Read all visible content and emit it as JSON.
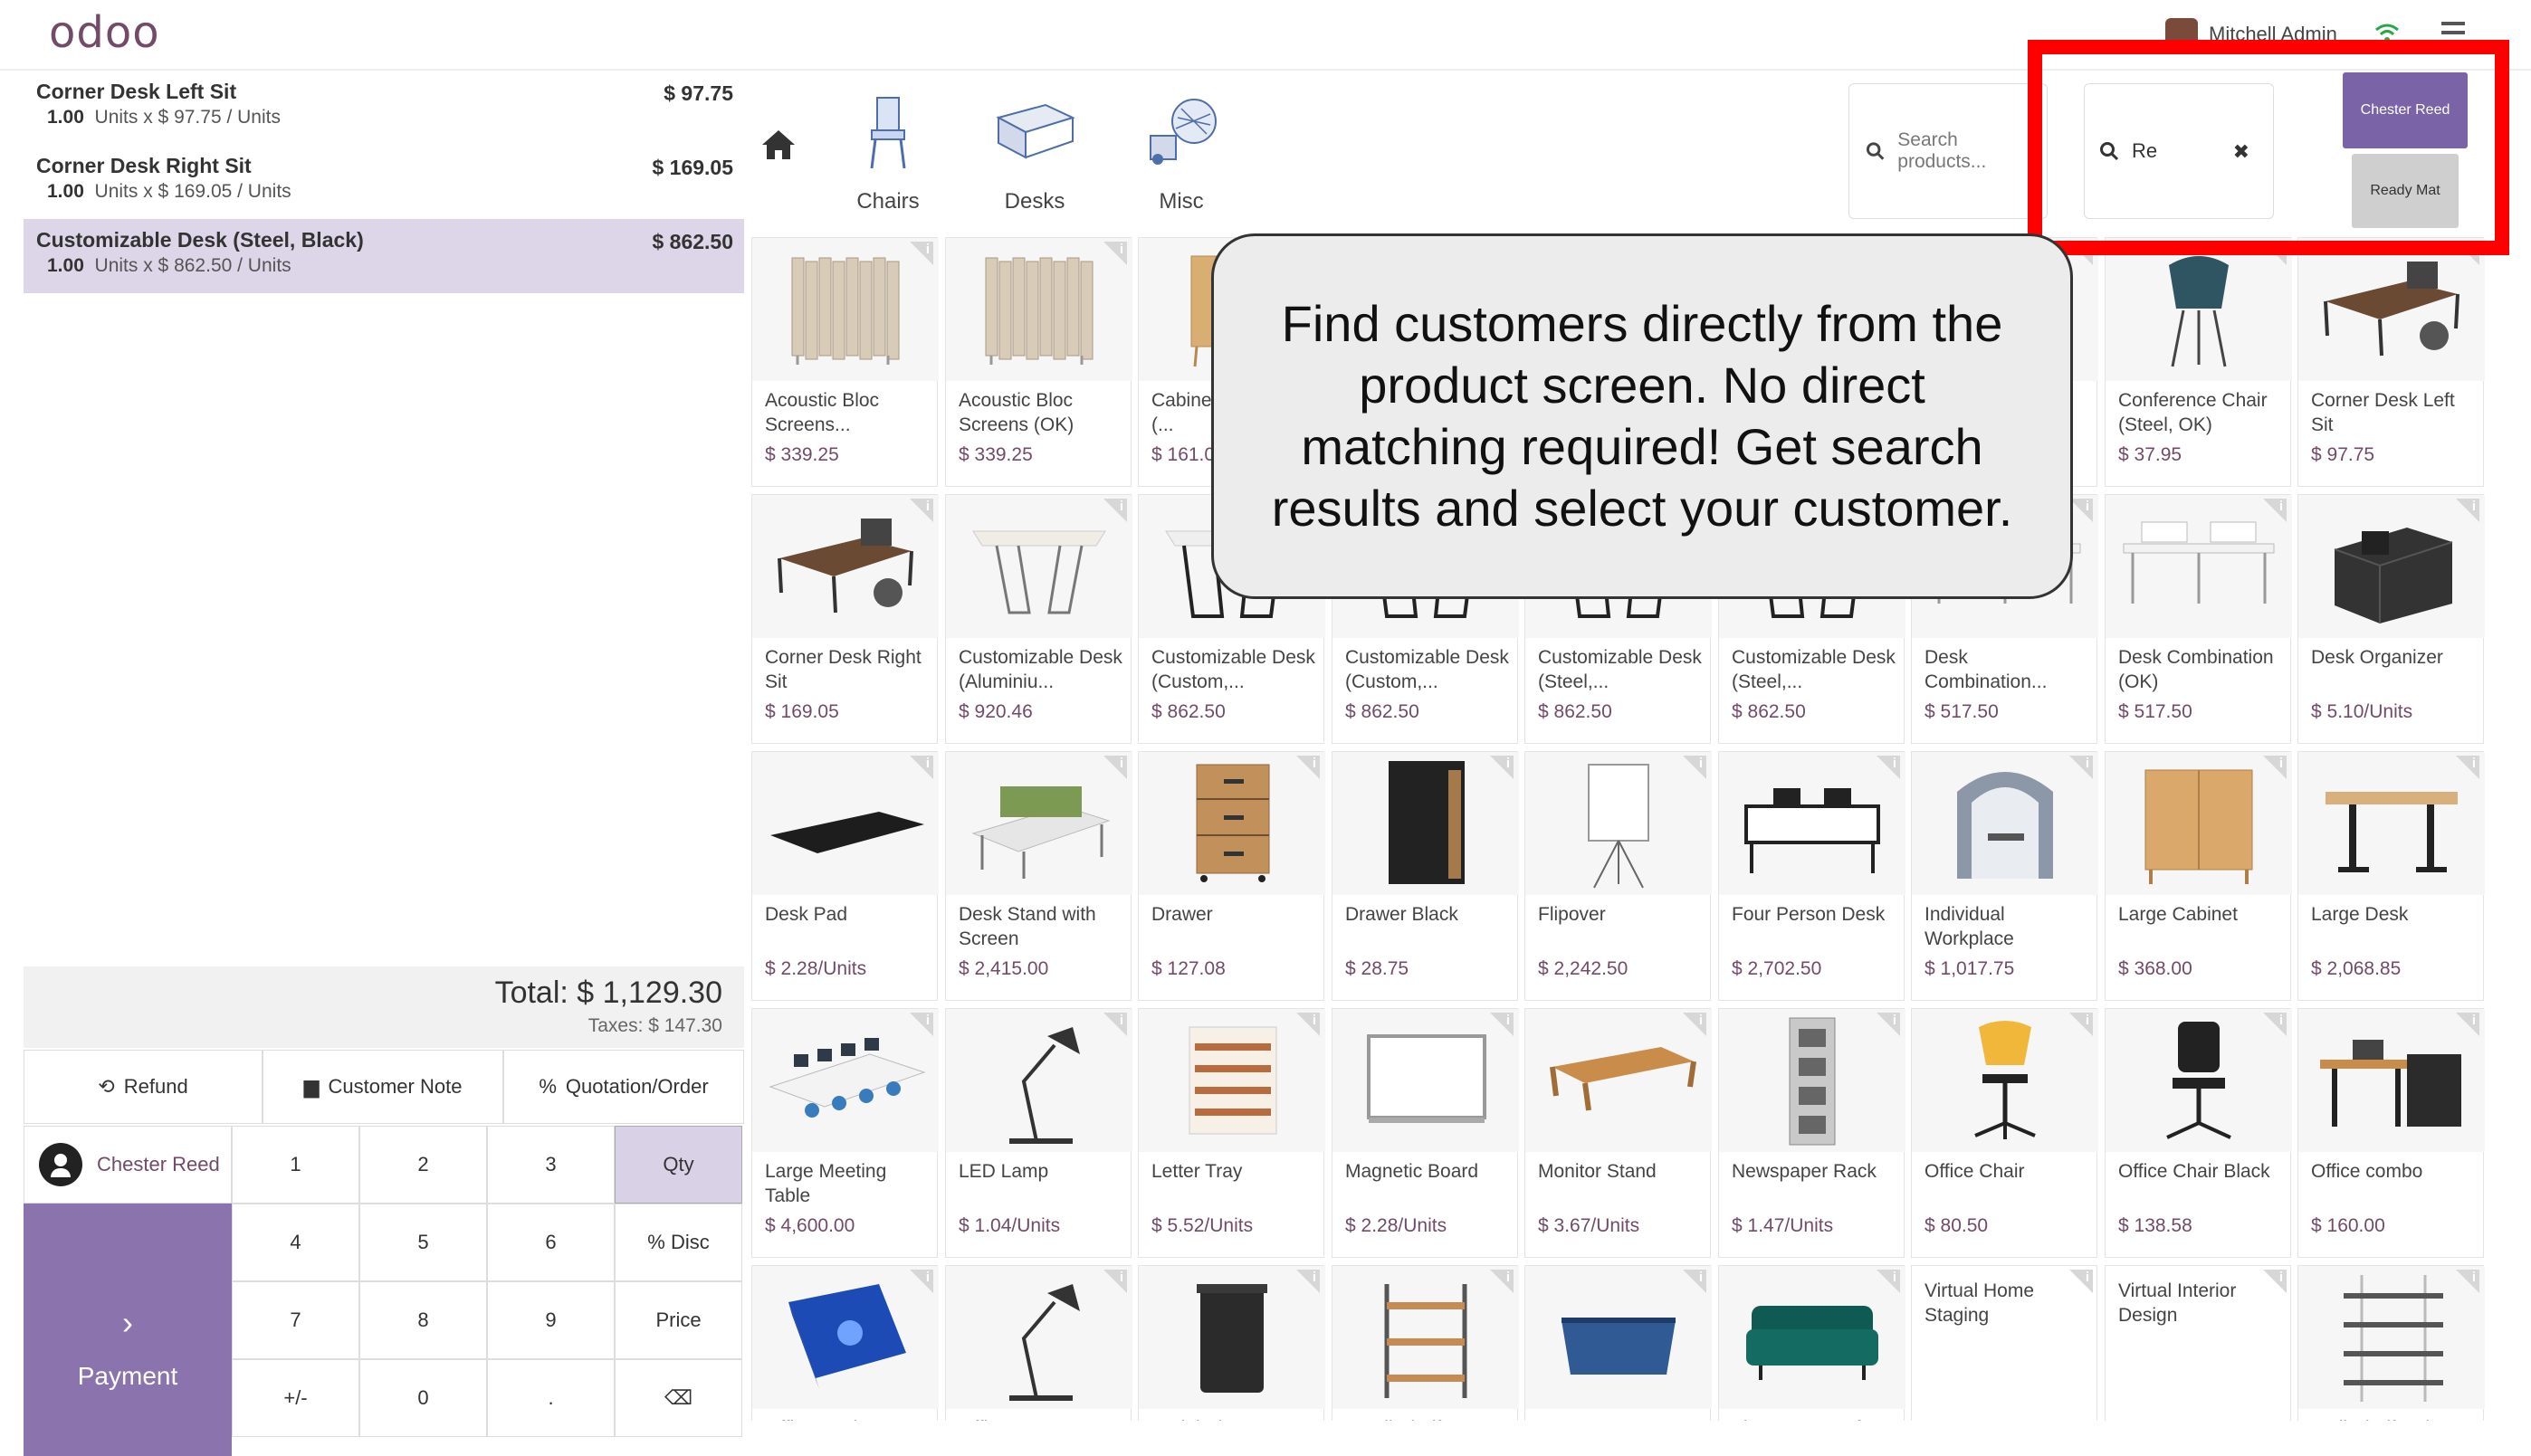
{
  "header": {
    "logo_main": "odoo",
    "user_name": "Mitchell Admin"
  },
  "order": {
    "lines": [
      {
        "name": "Corner Desk Left Sit",
        "qty": "1.00",
        "unit_text": "Units x $ 97.75 / Units",
        "price": "$ 97.75",
        "selected": false
      },
      {
        "name": "Corner Desk Right Sit",
        "qty": "1.00",
        "unit_text": "Units x $ 169.05 / Units",
        "price": "$ 169.05",
        "selected": false
      },
      {
        "name": "Customizable Desk (Steel, Black)",
        "qty": "1.00",
        "unit_text": "Units x $ 862.50 / Units",
        "price": "$ 862.50",
        "selected": true
      }
    ],
    "total": "Total: $ 1,129.30",
    "taxes": "Taxes: $ 147.30"
  },
  "controls": {
    "refund": "Refund",
    "customer_note": "Customer Note",
    "quotation": "Quotation/Order",
    "customer": "Chester Reed",
    "payment": "Payment"
  },
  "numpad": {
    "keys": [
      "1",
      "2",
      "3",
      "Qty",
      "4",
      "5",
      "6",
      "% Disc",
      "7",
      "8",
      "9",
      "Price",
      "+/-",
      "0",
      ".",
      "⌫"
    ],
    "active": "Qty"
  },
  "categories": [
    {
      "label": "Chairs",
      "icon": "chair-icon"
    },
    {
      "label": "Desks",
      "icon": "desk-icon"
    },
    {
      "label": "Misc",
      "icon": "misc-icon"
    }
  ],
  "search": {
    "product_placeholder": "Search products...",
    "customer_value": "Re",
    "results": [
      "Chester Reed",
      "Ready Mat"
    ]
  },
  "tooltip": "Find customers directly from the product screen. No direct matching required! Get search results and select your customer.",
  "products": [
    {
      "name": "Acoustic Bloc Screens...",
      "price": "$ 339.25",
      "img": "screen"
    },
    {
      "name": "Acoustic Bloc Screens (OK)",
      "price": "$ 339.25",
      "img": "screen"
    },
    {
      "name": "Cabinet with Doors (...",
      "price": "$ 161.00",
      "img": "cabinet"
    },
    {
      "name": "",
      "price": "",
      "img": "blank"
    },
    {
      "name": "",
      "price": "",
      "img": "blank"
    },
    {
      "name": "",
      "price": "",
      "img": "blank"
    },
    {
      "name": "",
      "price": "",
      "img": "blank"
    },
    {
      "name": "Conference Chair (Steel, OK)",
      "price": "$ 37.95",
      "img": "confchair"
    },
    {
      "name": "Corner Desk Left Sit",
      "price": "$ 97.75",
      "img": "cornerdesk"
    },
    {
      "name": "Corner Desk Right Sit",
      "price": "$ 169.05",
      "img": "cornerdesk"
    },
    {
      "name": "Customizable Desk (Aluminiu...",
      "price": "$ 920.46",
      "img": "tablewhite"
    },
    {
      "name": "Customizable Desk (Custom,...",
      "price": "$ 862.50",
      "img": "tableblack"
    },
    {
      "name": "Customizable Desk (Custom,...",
      "price": "$ 862.50",
      "img": "tableblack"
    },
    {
      "name": "Customizable Desk (Steel,...",
      "price": "$ 862.50",
      "img": "tableblack"
    },
    {
      "name": "Customizable Desk (Steel,...",
      "price": "$ 862.50",
      "img": "tableblack"
    },
    {
      "name": "Desk Combination...",
      "price": "$ 517.50",
      "img": "deskcombo"
    },
    {
      "name": "Desk Combination (OK)",
      "price": "$ 517.50",
      "img": "deskcombo"
    },
    {
      "name": "Desk Organizer",
      "price": "$ 5.10/Units",
      "img": "organizer"
    },
    {
      "name": "Desk Pad",
      "price": "$ 2.28/Units",
      "img": "deskpad"
    },
    {
      "name": "Desk Stand with Screen",
      "price": "$ 2,415.00",
      "img": "deskstand"
    },
    {
      "name": "Drawer",
      "price": "$ 127.08",
      "img": "drawer"
    },
    {
      "name": "Drawer Black",
      "price": "$ 28.75",
      "img": "drawerblack"
    },
    {
      "name": "Flipover",
      "price": "$ 2,242.50",
      "img": "flipover"
    },
    {
      "name": "Four Person Desk",
      "price": "$ 2,702.50",
      "img": "fourdesk"
    },
    {
      "name": "Individual Workplace",
      "price": "$ 1,017.75",
      "img": "workplace"
    },
    {
      "name": "Large Cabinet",
      "price": "$ 368.00",
      "img": "largecab"
    },
    {
      "name": "Large Desk",
      "price": "$ 2,068.85",
      "img": "largedesk"
    },
    {
      "name": "Large Meeting Table",
      "price": "$ 4,600.00",
      "img": "meeting"
    },
    {
      "name": "LED Lamp",
      "price": "$ 1.04/Units",
      "img": "lamp"
    },
    {
      "name": "Letter Tray",
      "price": "$ 5.52/Units",
      "img": "tray"
    },
    {
      "name": "Magnetic Board",
      "price": "$ 2.28/Units",
      "img": "board"
    },
    {
      "name": "Monitor Stand",
      "price": "$ 3.67/Units",
      "img": "monitorstand"
    },
    {
      "name": "Newspaper Rack",
      "price": "$ 1.47/Units",
      "img": "rack"
    },
    {
      "name": "Office Chair",
      "price": "$ 80.50",
      "img": "officechair"
    },
    {
      "name": "Office Chair Black",
      "price": "$ 138.58",
      "img": "chairblack"
    },
    {
      "name": "Office combo",
      "price": "$ 160.00",
      "img": "combo"
    },
    {
      "name": "Office Design Software",
      "price": "",
      "img": "software"
    },
    {
      "name": "Office Lamp",
      "price": "",
      "img": "lamp"
    },
    {
      "name": "Pedal Bin",
      "price": "",
      "img": "bin"
    },
    {
      "name": "Small Shelf",
      "price": "",
      "img": "shelf"
    },
    {
      "name": "Storage Box",
      "price": "",
      "img": "box"
    },
    {
      "name": "Three-Seat Sofa",
      "price": "",
      "img": "sofa"
    },
    {
      "name": "Virtual Home Staging",
      "price": "",
      "img": "none"
    },
    {
      "name": "Virtual Interior Design",
      "price": "",
      "img": "none"
    },
    {
      "name": "Wall Shelf Unit",
      "price": "",
      "img": "wallshelf"
    }
  ]
}
